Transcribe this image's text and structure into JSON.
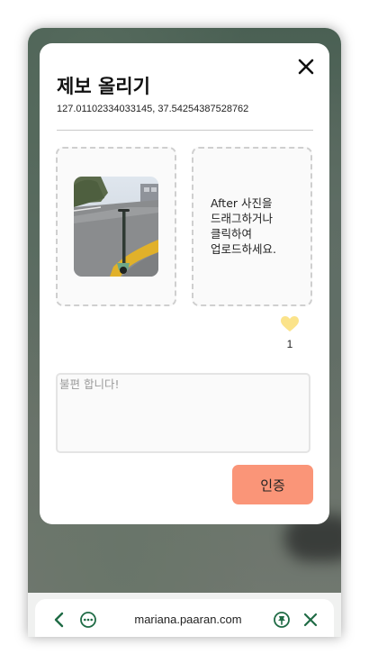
{
  "modal": {
    "title": "제보 올리기",
    "coordinates": "127.01102334033145, 37.54254387528762",
    "after_upload_prompt": "After 사진을 드래그하거나 클릭하여 업로드하세요.",
    "like_count": "1",
    "complaint_placeholder": "불편 합니다!",
    "complaint_value": "",
    "submit_label": "인증"
  },
  "browser": {
    "url": "mariana.paaran.com"
  },
  "icons": {
    "close": "close-icon",
    "heart": "heart-icon",
    "back": "chevron-left-icon",
    "more": "more-icon",
    "pin": "pin-icon",
    "exit": "close-icon"
  },
  "colors": {
    "accent_button": "#fa9578",
    "heart": "#fbe38a",
    "toolbar_icon": "#1f6b45",
    "modal_background": "#ffffff"
  }
}
